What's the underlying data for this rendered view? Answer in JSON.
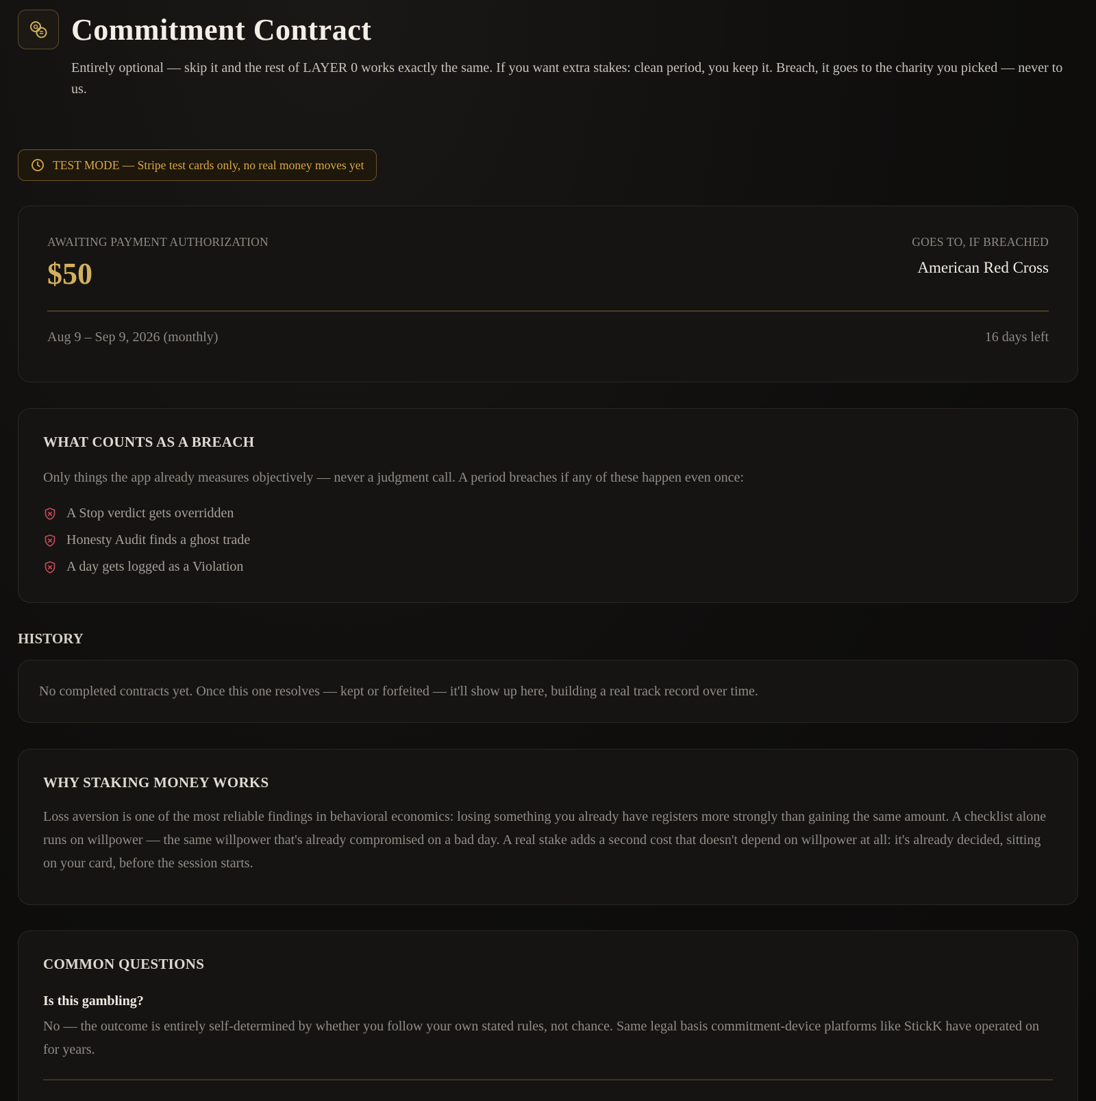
{
  "header": {
    "title": "Commitment Contract",
    "subtitle": "Entirely optional — skip it and the rest of LAYER 0 works exactly the same. If you want extra stakes: clean period, you keep it. Breach, it goes to the charity you picked — never to us.",
    "logo_icon": "coins-icon"
  },
  "test_mode": {
    "icon": "clock-icon",
    "label": "TEST MODE — Stripe test cards only, no real money moves yet"
  },
  "status": {
    "state_label": "AWAITING PAYMENT AUTHORIZATION",
    "amount": "$50",
    "charity_label": "GOES TO, IF BREACHED",
    "charity_name": "American Red Cross",
    "period": "Aug 9 – Sep 9, 2026 (monthly)",
    "remaining": "16 days left"
  },
  "breach": {
    "heading": "WHAT COUNTS AS A BREACH",
    "intro": "Only things the app already measures objectively — never a judgment call. A period breaches if any of these happen even once:",
    "items": [
      "A Stop verdict gets overridden",
      "Honesty Audit finds a ghost trade",
      "A day gets logged as a Violation"
    ],
    "item_icon": "shield-x-icon"
  },
  "history": {
    "heading": "HISTORY",
    "empty_text": "No completed contracts yet. Once this one resolves — kept or forfeited — it'll show up here, building a real track record over time."
  },
  "why": {
    "heading": "WHY STAKING MONEY WORKS",
    "body": "Loss aversion is one of the most reliable findings in behavioral economics: losing something you already have registers more strongly than gaining the same amount. A checklist alone runs on willpower — the same willpower that's already compromised on a bad day. A real stake adds a second cost that doesn't depend on willpower at all: it's already decided, sitting on your card, before the session starts."
  },
  "faq": {
    "heading": "COMMON QUESTIONS",
    "items": [
      {
        "question": "Is this gambling?",
        "answer": "No — the outcome is entirely self-determined by whether you follow your own stated rules, not chance. Same legal basis commitment-device platforms like StickK have operated on for years."
      }
    ]
  },
  "colors": {
    "accent_gold": "#d2b05c",
    "warning_amber": "#d7a948",
    "breach_red": "#c24a55"
  }
}
